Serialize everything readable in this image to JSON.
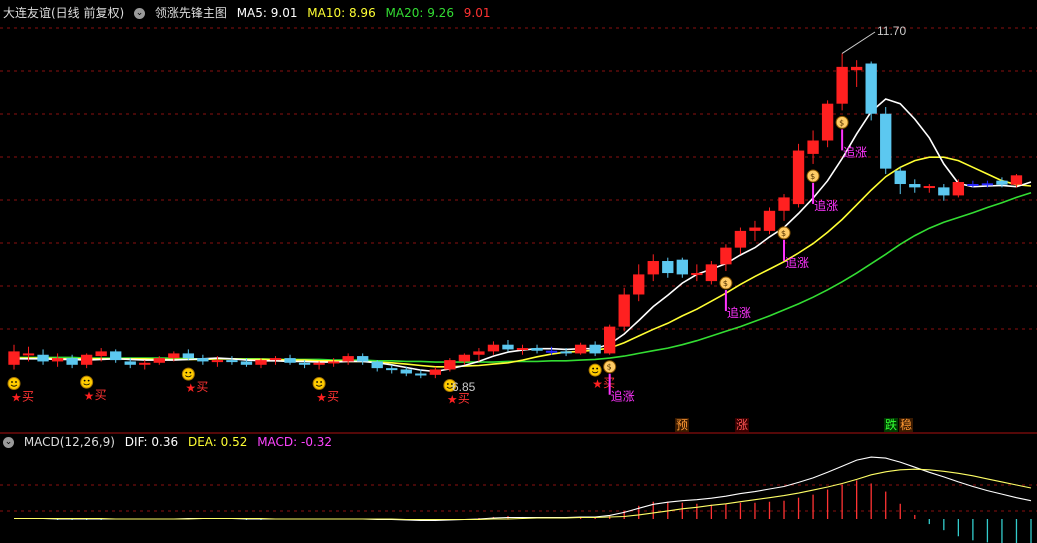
{
  "header": {
    "title": "大连友谊(日线 前复权)",
    "indicator_name": "领涨先锋主图",
    "ma5_label": "MA5: 9.01",
    "ma10_label": "MA10: 8.96",
    "ma20_label": "MA20: 9.26",
    "last_label": "9.01"
  },
  "macd_header": {
    "name": "MACD(12,26,9)",
    "dif_label": "DIF: 0.36",
    "dea_label": "DEA: 0.52",
    "macd_label": "MACD: -0.32"
  },
  "colors": {
    "up": "#ff2020",
    "down": "#5cc8f0",
    "flat": "#2a2aff",
    "ma5": "#ffffff",
    "ma10": "#ffff33",
    "ma20": "#33dd33",
    "grid": "#8a1010",
    "signal_text": "#ff33ff"
  },
  "markers": {
    "high_label": "11.70",
    "low_label": "6.85",
    "buy_label": "买",
    "chase_label": "追涨"
  },
  "tags": {
    "yu": "预",
    "zhang": "涨",
    "die": "跌",
    "wen": "稳"
  },
  "chart_data": {
    "type": "candlestick",
    "title": "大连友谊(日线 前复权)",
    "ylim": [
      6.3,
      12.2
    ],
    "candles": [
      {
        "o": 7.05,
        "h": 7.35,
        "l": 6.98,
        "c": 7.25
      },
      {
        "o": 7.2,
        "h": 7.32,
        "l": 7.1,
        "c": 7.22
      },
      {
        "o": 7.2,
        "h": 7.28,
        "l": 7.05,
        "c": 7.1
      },
      {
        "o": 7.1,
        "h": 7.22,
        "l": 7.02,
        "c": 7.15
      },
      {
        "o": 7.15,
        "h": 7.2,
        "l": 7.0,
        "c": 7.05
      },
      {
        "o": 7.05,
        "h": 7.22,
        "l": 7.0,
        "c": 7.2
      },
      {
        "o": 7.18,
        "h": 7.3,
        "l": 7.1,
        "c": 7.25
      },
      {
        "o": 7.25,
        "h": 7.28,
        "l": 7.08,
        "c": 7.12
      },
      {
        "o": 7.1,
        "h": 7.15,
        "l": 7.0,
        "c": 7.05
      },
      {
        "o": 7.05,
        "h": 7.12,
        "l": 6.98,
        "c": 7.08
      },
      {
        "o": 7.08,
        "h": 7.18,
        "l": 7.05,
        "c": 7.15
      },
      {
        "o": 7.15,
        "h": 7.25,
        "l": 7.1,
        "c": 7.22
      },
      {
        "o": 7.22,
        "h": 7.28,
        "l": 7.12,
        "c": 7.15
      },
      {
        "o": 7.15,
        "h": 7.2,
        "l": 7.05,
        "c": 7.1
      },
      {
        "o": 7.1,
        "h": 7.18,
        "l": 7.02,
        "c": 7.12
      },
      {
        "o": 7.12,
        "h": 7.18,
        "l": 7.05,
        "c": 7.1
      },
      {
        "o": 7.1,
        "h": 7.15,
        "l": 7.02,
        "c": 7.05
      },
      {
        "o": 7.05,
        "h": 7.15,
        "l": 7.0,
        "c": 7.12
      },
      {
        "o": 7.12,
        "h": 7.18,
        "l": 7.05,
        "c": 7.15
      },
      {
        "o": 7.15,
        "h": 7.2,
        "l": 7.05,
        "c": 7.08
      },
      {
        "o": 7.08,
        "h": 7.12,
        "l": 7.0,
        "c": 7.05
      },
      {
        "o": 7.05,
        "h": 7.1,
        "l": 6.98,
        "c": 7.08
      },
      {
        "o": 7.08,
        "h": 7.15,
        "l": 7.02,
        "c": 7.1
      },
      {
        "o": 7.1,
        "h": 7.22,
        "l": 7.05,
        "c": 7.18
      },
      {
        "o": 7.18,
        "h": 7.22,
        "l": 7.05,
        "c": 7.1
      },
      {
        "o": 7.1,
        "h": 7.12,
        "l": 6.95,
        "c": 7.0
      },
      {
        "o": 7.0,
        "h": 7.05,
        "l": 6.92,
        "c": 6.98
      },
      {
        "o": 6.98,
        "h": 7.02,
        "l": 6.88,
        "c": 6.92
      },
      {
        "o": 6.92,
        "h": 6.98,
        "l": 6.85,
        "c": 6.9
      },
      {
        "o": 6.9,
        "h": 7.02,
        "l": 6.85,
        "c": 6.98
      },
      {
        "o": 6.98,
        "h": 7.15,
        "l": 6.95,
        "c": 7.12
      },
      {
        "o": 7.1,
        "h": 7.22,
        "l": 7.05,
        "c": 7.2
      },
      {
        "o": 7.2,
        "h": 7.3,
        "l": 7.1,
        "c": 7.25
      },
      {
        "o": 7.25,
        "h": 7.4,
        "l": 7.2,
        "c": 7.35
      },
      {
        "o": 7.35,
        "h": 7.42,
        "l": 7.25,
        "c": 7.28
      },
      {
        "o": 7.28,
        "h": 7.35,
        "l": 7.2,
        "c": 7.3
      },
      {
        "o": 7.3,
        "h": 7.35,
        "l": 7.22,
        "c": 7.26
      },
      {
        "o": 7.26,
        "h": 7.32,
        "l": 7.2,
        "c": 7.25
      },
      {
        "o": 7.25,
        "h": 7.3,
        "l": 7.18,
        "c": 7.22
      },
      {
        "o": 7.22,
        "h": 7.38,
        "l": 7.2,
        "c": 7.35
      },
      {
        "o": 7.35,
        "h": 7.4,
        "l": 7.18,
        "c": 7.22
      },
      {
        "o": 7.22,
        "h": 7.65,
        "l": 7.2,
        "c": 7.62
      },
      {
        "o": 7.62,
        "h": 8.2,
        "l": 7.55,
        "c": 8.1
      },
      {
        "o": 8.1,
        "h": 8.55,
        "l": 8.0,
        "c": 8.4
      },
      {
        "o": 8.4,
        "h": 8.7,
        "l": 8.3,
        "c": 8.6
      },
      {
        "o": 8.6,
        "h": 8.65,
        "l": 8.35,
        "c": 8.42
      },
      {
        "o": 8.62,
        "h": 8.65,
        "l": 8.35,
        "c": 8.4
      },
      {
        "o": 8.4,
        "h": 8.55,
        "l": 8.3,
        "c": 8.42
      },
      {
        "o": 8.3,
        "h": 8.6,
        "l": 8.25,
        "c": 8.55
      },
      {
        "o": 8.55,
        "h": 8.85,
        "l": 8.45,
        "c": 8.8
      },
      {
        "o": 8.8,
        "h": 9.1,
        "l": 8.7,
        "c": 9.05
      },
      {
        "o": 9.05,
        "h": 9.2,
        "l": 8.9,
        "c": 9.1
      },
      {
        "o": 9.05,
        "h": 9.4,
        "l": 9.0,
        "c": 9.35
      },
      {
        "o": 9.35,
        "h": 9.6,
        "l": 9.2,
        "c": 9.55
      },
      {
        "o": 9.45,
        "h": 10.35,
        "l": 9.4,
        "c": 10.25
      },
      {
        "o": 10.2,
        "h": 10.55,
        "l": 10.05,
        "c": 10.4
      },
      {
        "o": 10.4,
        "h": 11.0,
        "l": 10.3,
        "c": 10.95
      },
      {
        "o": 10.95,
        "h": 11.7,
        "l": 10.85,
        "c": 11.5
      },
      {
        "o": 11.45,
        "h": 11.6,
        "l": 11.2,
        "c": 11.5
      },
      {
        "o": 11.55,
        "h": 11.58,
        "l": 10.7,
        "c": 10.8
      },
      {
        "o": 10.8,
        "h": 10.9,
        "l": 9.9,
        "c": 9.98
      },
      {
        "o": 9.95,
        "h": 10.0,
        "l": 9.6,
        "c": 9.75
      },
      {
        "o": 9.75,
        "h": 9.82,
        "l": 9.62,
        "c": 9.7
      },
      {
        "o": 9.7,
        "h": 9.75,
        "l": 9.62,
        "c": 9.72
      },
      {
        "o": 9.7,
        "h": 9.75,
        "l": 9.5,
        "c": 9.58
      },
      {
        "o": 9.58,
        "h": 9.82,
        "l": 9.55,
        "c": 9.78
      },
      {
        "o": 9.75,
        "h": 9.8,
        "l": 9.7,
        "c": 9.75
      },
      {
        "o": 9.75,
        "h": 9.8,
        "l": 9.7,
        "c": 9.76
      },
      {
        "o": 9.8,
        "h": 9.85,
        "l": 9.7,
        "c": 9.74
      },
      {
        "o": 9.74,
        "h": 9.9,
        "l": 9.7,
        "c": 9.88
      }
    ],
    "ma5": [
      7.14,
      7.14,
      7.14,
      7.13,
      7.13,
      7.12,
      7.13,
      7.14,
      7.13,
      7.12,
      7.12,
      7.12,
      7.13,
      7.14,
      7.15,
      7.14,
      7.12,
      7.11,
      7.11,
      7.1,
      7.1,
      7.09,
      7.09,
      7.1,
      7.1,
      7.08,
      7.05,
      7.01,
      6.97,
      6.95,
      6.99,
      7.04,
      7.1,
      7.18,
      7.24,
      7.27,
      7.29,
      7.29,
      7.28,
      7.29,
      7.29,
      7.36,
      7.51,
      7.71,
      7.92,
      8.09,
      8.27,
      8.4,
      8.48,
      8.56,
      8.69,
      8.8,
      8.96,
      9.1,
      9.31,
      9.54,
      9.8,
      10.13,
      10.5,
      10.83,
      11.02,
      10.95,
      10.72,
      10.44,
      10.05,
      9.76,
      9.71,
      9.72,
      9.73,
      9.71,
      9.78
    ],
    "ma10": [
      7.15,
      7.15,
      7.15,
      7.14,
      7.14,
      7.14,
      7.14,
      7.14,
      7.14,
      7.14,
      7.13,
      7.13,
      7.13,
      7.13,
      7.14,
      7.14,
      7.13,
      7.13,
      7.13,
      7.12,
      7.12,
      7.11,
      7.11,
      7.1,
      7.1,
      7.09,
      7.08,
      7.06,
      7.04,
      7.02,
      7.02,
      7.03,
      7.04,
      7.06,
      7.08,
      7.12,
      7.17,
      7.21,
      7.24,
      7.25,
      7.27,
      7.3,
      7.38,
      7.48,
      7.58,
      7.67,
      7.78,
      7.88,
      8.0,
      8.12,
      8.25,
      8.37,
      8.48,
      8.59,
      8.72,
      8.86,
      9.03,
      9.22,
      9.44,
      9.66,
      9.86,
      10.0,
      10.1,
      10.15,
      10.15,
      10.1,
      10.0,
      9.9,
      9.8,
      9.74,
      9.72
    ],
    "ma20": [
      7.16,
      7.16,
      7.16,
      7.16,
      7.16,
      7.15,
      7.15,
      7.15,
      7.15,
      7.15,
      7.15,
      7.15,
      7.14,
      7.14,
      7.14,
      7.14,
      7.14,
      7.14,
      7.13,
      7.13,
      7.13,
      7.13,
      7.12,
      7.12,
      7.12,
      7.11,
      7.11,
      7.1,
      7.1,
      7.09,
      7.09,
      7.09,
      7.09,
      7.09,
      7.1,
      7.1,
      7.1,
      7.11,
      7.11,
      7.12,
      7.13,
      7.15,
      7.18,
      7.22,
      7.26,
      7.3,
      7.35,
      7.41,
      7.48,
      7.55,
      7.62,
      7.7,
      7.78,
      7.87,
      7.96,
      8.06,
      8.17,
      8.29,
      8.42,
      8.56,
      8.7,
      8.85,
      8.98,
      9.09,
      9.18,
      9.25,
      9.32,
      9.4,
      9.47,
      9.55,
      9.62
    ],
    "signals": [
      {
        "i": 0,
        "type": "buy"
      },
      {
        "i": 5,
        "type": "buy"
      },
      {
        "i": 12,
        "type": "buy"
      },
      {
        "i": 21,
        "type": "buy"
      },
      {
        "i": 30,
        "type": "buy"
      },
      {
        "i": 40,
        "type": "buy"
      },
      {
        "i": 41,
        "type": "chase"
      },
      {
        "i": 49,
        "type": "chase"
      },
      {
        "i": 53,
        "type": "chase"
      },
      {
        "i": 55,
        "type": "chase"
      },
      {
        "i": 57,
        "type": "chase"
      }
    ],
    "macd": {
      "dif": [
        0.01,
        0.01,
        0.01,
        0.0,
        0.0,
        0.0,
        0.0,
        0.0,
        0.0,
        0.0,
        0.0,
        0.0,
        0.01,
        0.01,
        0.01,
        0.01,
        0.0,
        0.0,
        0.0,
        0.0,
        0.0,
        0.0,
        0.0,
        0.0,
        0.0,
        -0.01,
        -0.01,
        -0.02,
        -0.03,
        -0.03,
        -0.02,
        -0.01,
        0.0,
        0.02,
        0.03,
        0.03,
        0.03,
        0.03,
        0.03,
        0.04,
        0.04,
        0.07,
        0.13,
        0.21,
        0.29,
        0.33,
        0.36,
        0.38,
        0.41,
        0.45,
        0.5,
        0.54,
        0.59,
        0.64,
        0.72,
        0.81,
        0.92,
        1.04,
        1.16,
        1.22,
        1.2,
        1.12,
        1.02,
        0.92,
        0.83,
        0.73,
        0.64,
        0.56,
        0.49,
        0.42,
        0.36
      ],
      "dea": [
        0.01,
        0.01,
        0.01,
        0.01,
        0.01,
        0.01,
        0.01,
        0.0,
        0.0,
        0.0,
        0.0,
        0.0,
        0.0,
        0.01,
        0.01,
        0.01,
        0.01,
        0.01,
        0.0,
        0.0,
        0.0,
        0.0,
        0.0,
        0.0,
        0.0,
        0.0,
        0.0,
        -0.01,
        -0.01,
        -0.01,
        -0.01,
        -0.01,
        -0.01,
        0.0,
        0.0,
        0.01,
        0.02,
        0.02,
        0.02,
        0.03,
        0.03,
        0.04,
        0.05,
        0.08,
        0.12,
        0.16,
        0.2,
        0.23,
        0.27,
        0.3,
        0.34,
        0.38,
        0.42,
        0.46,
        0.51,
        0.57,
        0.63,
        0.7,
        0.78,
        0.87,
        0.93,
        0.97,
        0.98,
        0.97,
        0.94,
        0.9,
        0.85,
        0.79,
        0.73,
        0.67,
        0.61
      ]
    }
  }
}
